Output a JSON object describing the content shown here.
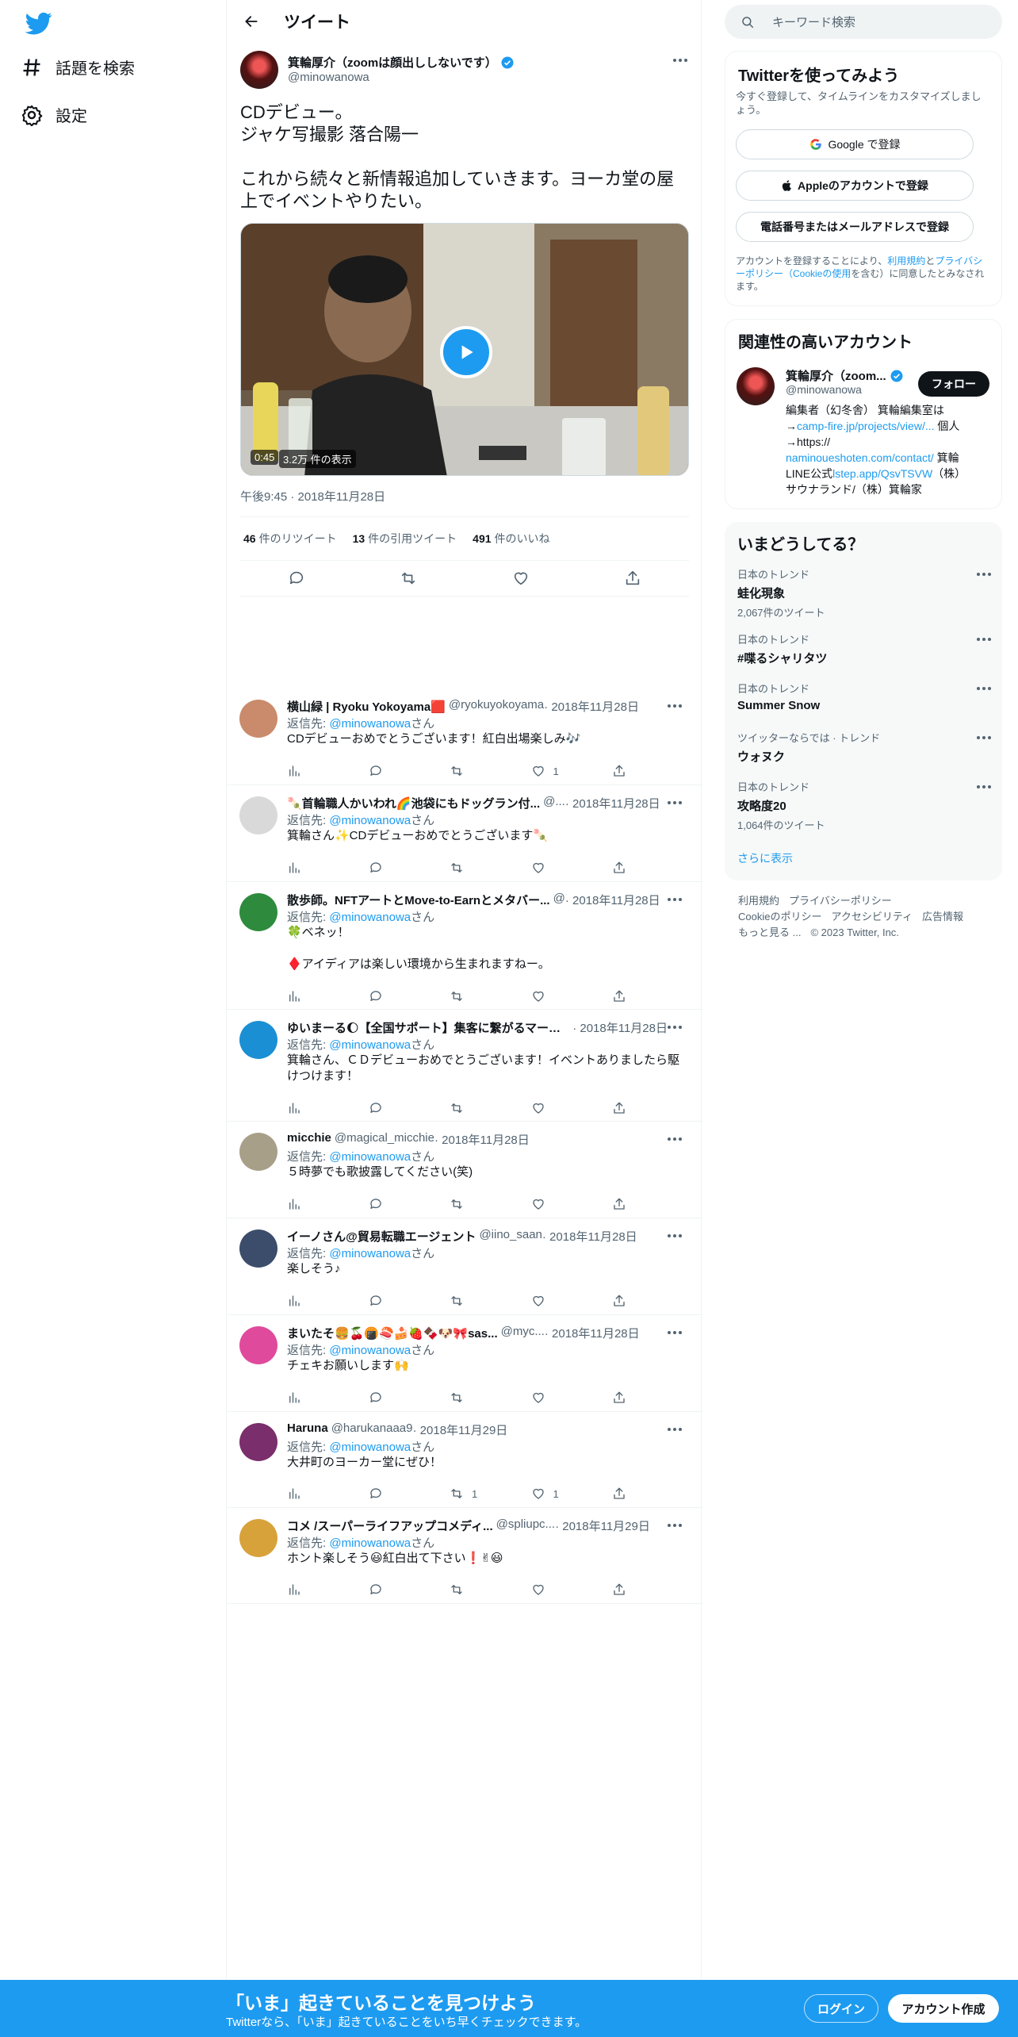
{
  "nav": {
    "explore": "話題を検索",
    "settings": "設定"
  },
  "header": {
    "title": "ツイート"
  },
  "tweet": {
    "name": "箕輪厚介（zoomは顔出ししないです）",
    "handle": "@minowanowa",
    "text": "CDデビュー。\nジャケ写撮影 落合陽一\n\nこれから続々と新情報追加していきます。ヨーカ堂の屋上でイベントやりたい。",
    "duration": "0:45",
    "views": "3.2万 件の表示",
    "time": "午後9:45 · 2018年11月28日",
    "retweets": "46",
    "retweets_label": "件のリツイート",
    "quotes": "13",
    "quotes_label": "件の引用ツイート",
    "likes": "491",
    "likes_label": "件のいいね"
  },
  "replies": [
    {
      "name": "横山緑 | Ryoku Yokoyama🟥",
      "handle": "@ryokuyokoyama",
      "date": " · 2018年11月28日",
      "to_prefix": "返信先: ",
      "to": "@minowanowa",
      "to_suffix": "さん",
      "text": "CDデビューおめでとうございます！紅白出場楽しみ🎶",
      "rt": "",
      "like": "1",
      "avcolor": "#c98b6b"
    },
    {
      "name": "🍡首輪職人かいわれ🌈池袋にもドッグラン付...",
      "handle": "@...",
      "date": " · 2018年11月28日",
      "to_prefix": "返信先: ",
      "to": "@minowanowa",
      "to_suffix": "さん",
      "text": "箕輪さん✨CDデビューおめでとうございます🍡",
      "rt": "",
      "like": "",
      "avcolor": "#d9d9d9"
    },
    {
      "name": "散歩師。NFTアートとMove-to-Earnとメタバー...",
      "handle": "@",
      "date": " · 2018年11月28日",
      "to_prefix": "返信先: ",
      "to": "@minowanowa",
      "to_suffix": "さん",
      "text": "🍀ベネッ！\n\n♦️アイディアは楽しい環境から生まれますねー。",
      "rt": "",
      "like": "",
      "avcolor": "#2e8b3d"
    },
    {
      "name": "ゆいまーる🌔【全国サポート】集客に繋がるマーケ...",
      "handle": "",
      "date": " · 2018年11月28日",
      "to_prefix": "返信先: ",
      "to": "@minowanowa",
      "to_suffix": "さん",
      "text": "箕輪さん、ＣＤデビューおめでとうございます！イベントありましたら駆けつけます！",
      "rt": "",
      "like": "",
      "avcolor": "#1a8fd4"
    },
    {
      "name": "micchie",
      "handle": "@magical_micchie",
      "date": " · 2018年11月28日",
      "to_prefix": "返信先: ",
      "to": "@minowanowa",
      "to_suffix": "さん",
      "text": "５時夢でも歌披露してください(笑)",
      "rt": "",
      "like": "",
      "avcolor": "#a89f88"
    },
    {
      "name": "イーノさん@貿易転職エージェント",
      "handle": "@iino_saan",
      "date": " · 2018年11月28日",
      "to_prefix": "返信先: ",
      "to": "@minowanowa",
      "to_suffix": "さん",
      "text": "楽しそう♪",
      "rt": "",
      "like": "",
      "avcolor": "#3c4d6b"
    },
    {
      "name": "まいたそ🍔🍒🍘🍣🍰🍓🍫🐶🎀sas...",
      "handle": "@myc...",
      "date": " · 2018年11月28日",
      "to_prefix": "返信先: ",
      "to": "@minowanowa",
      "to_suffix": "さん",
      "text": "チェキお願いします🙌",
      "rt": "",
      "like": "",
      "avcolor": "#e04a9c"
    },
    {
      "name": "Haruna",
      "handle": "@harukanaaa9",
      "date": " · 2018年11月29日",
      "to_prefix": "返信先: ",
      "to": "@minowanowa",
      "to_suffix": "さん",
      "text": "大井町のヨーカー堂にぜひ！",
      "rt": "1",
      "like": "1",
      "avcolor": "#7a2e6b"
    },
    {
      "name": "コメ /スーパーライフアップコメディ...",
      "handle": "@spliupc...",
      "date": " · 2018年11月29日",
      "to_prefix": "返信先: ",
      "to": "@minowanowa",
      "to_suffix": "さん",
      "text": "ホント楽しそう😃紅白出て下さい❗✌😃",
      "rt": "",
      "like": "",
      "avcolor": "#d8a23a"
    }
  ],
  "search": {
    "placeholder": "キーワード検索"
  },
  "signup": {
    "title": "Twitterを使ってみよう",
    "desc": "今すぐ登録して、タイムラインをカスタマイズしましょう。",
    "google": "Google で登録",
    "apple": "Appleのアカウントで登録",
    "phone": "電話番号またはメールアドレスで登録",
    "terms_pre": "アカウントを登録することにより、",
    "terms_link1": "利用規約",
    "terms_and": "と",
    "terms_link2": "プライバシーポリシー（Cookieの使用",
    "terms_post": "を含む）に同意したとみなされます。"
  },
  "related": {
    "title": "関連性の高いアカウント",
    "name": "箕輪厚介（zoom...",
    "handle": "@minowanowa",
    "follow": "フォロー",
    "bio1": "編集者（幻冬舎） 箕輪編集室は",
    "bio2a": "→",
    "bio2link": "camp-fire.jp/projects/view/...",
    "bio2b": " 個人",
    "bio3": "→https://",
    "bio4link": "naminoueshoten.com/contact/",
    "bio4b": " 箕輪",
    "bio5a": "LINE公式",
    "bio5link": "lstep.app/QsvTSVW",
    "bio5b": "（株）",
    "bio6": "サウナランド/（株）箕輪家"
  },
  "trends": {
    "title": "いまどうしてる？",
    "items": [
      {
        "cat": "日本のトレンド",
        "name": "蛙化現象",
        "posts": "2,067件のツイート"
      },
      {
        "cat": "日本のトレンド",
        "name": "#喋るシャリタツ",
        "posts": ""
      },
      {
        "cat": "日本のトレンド",
        "name": "Summer Snow",
        "posts": ""
      },
      {
        "cat": "ツイッターならでは · トレンド",
        "name": "ウォヌク",
        "posts": ""
      },
      {
        "cat": "日本のトレンド",
        "name": "攻略度20",
        "posts": "1,064件のツイート"
      }
    ],
    "more": "さらに表示"
  },
  "footer": {
    "l1": "利用規約",
    "l2": "プライバシーポリシー",
    "l3": "Cookieのポリシー",
    "l4": "アクセシビリティ",
    "l5": "広告情報",
    "l6": "もっと見る ...",
    "copy": "© 2023 Twitter, Inc."
  },
  "bottom": {
    "title": "「いま」起きていることを見つけよう",
    "sub": "Twitterなら、「いま」起きていることをいち早くチェックできます。",
    "login": "ログイン",
    "signup": "アカウント作成"
  },
  "colors": {
    "accent": "#1d9bf0",
    "text": "#0f1419",
    "muted": "#536471"
  }
}
